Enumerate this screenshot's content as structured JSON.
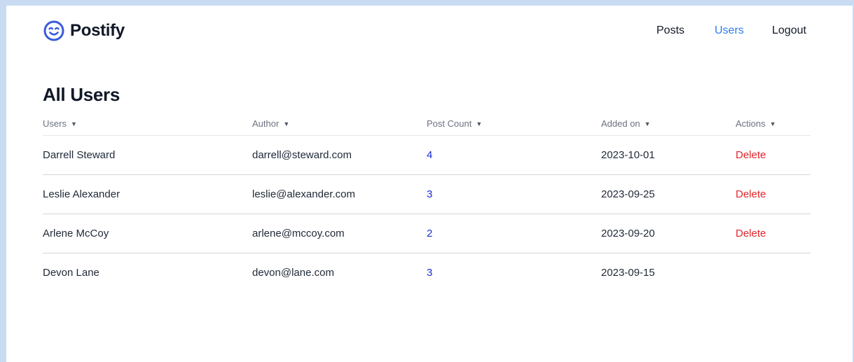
{
  "brand": {
    "name": "Postify",
    "icon": "smile-icon",
    "color": "#3b5bdb"
  },
  "nav": {
    "posts": "Posts",
    "users": "Users",
    "logout": "Logout",
    "active": "users",
    "active_color": "#2f80ed"
  },
  "page": {
    "title": "All Users"
  },
  "table": {
    "headers": [
      "Users",
      "Author",
      "Post Count",
      "Added on",
      "Actions"
    ],
    "sort_icon": "caret-down-icon",
    "rows": [
      {
        "user": "Darrell Steward",
        "email": "darrell@steward.com",
        "post_count": "4",
        "added_on": "2023-10-01",
        "action": "Delete"
      },
      {
        "user": "Leslie Alexander",
        "email": "leslie@alexander.com",
        "post_count": "3",
        "added_on": "2023-09-25",
        "action": "Delete"
      },
      {
        "user": "Arlene McCoy",
        "email": "arlene@mccoy.com",
        "post_count": "2",
        "added_on": "2023-09-20",
        "action": "Delete"
      },
      {
        "user": "Devon Lane",
        "email": "devon@lane.com",
        "post_count": "3",
        "added_on": "2023-09-15",
        "action": ""
      }
    ],
    "link_color": "#1d2bd6",
    "delete_color": "#e3242b"
  }
}
